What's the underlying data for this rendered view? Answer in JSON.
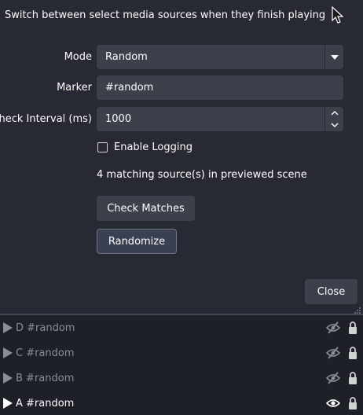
{
  "dialog": {
    "description": "Switch between select media sources when they finish playing",
    "mode_label": "Mode",
    "mode_value": "Random",
    "marker_label": "Marker",
    "marker_value": "#random",
    "interval_label": "Check Interval (ms)",
    "interval_value": "1000",
    "logging_label": "Enable Logging",
    "logging_checked": false,
    "matching_info": "4 matching source(s) in previewed scene",
    "check_matches_label": "Check Matches",
    "randomize_label": "Randomize",
    "close_label": "Close"
  },
  "sources": [
    {
      "name": "D #random",
      "visible": false,
      "locked": true
    },
    {
      "name": "C #random",
      "visible": false,
      "locked": true
    },
    {
      "name": "B #random",
      "visible": false,
      "locked": true
    },
    {
      "name": "A #random",
      "visible": true,
      "locked": true
    }
  ],
  "colors": {
    "background": "#272a33",
    "field": "#3c404b",
    "list_background": "#1e2028",
    "text_active": "#fefefe",
    "text_hidden": "#8b8d94",
    "accent_line": "#3f4b5c"
  }
}
